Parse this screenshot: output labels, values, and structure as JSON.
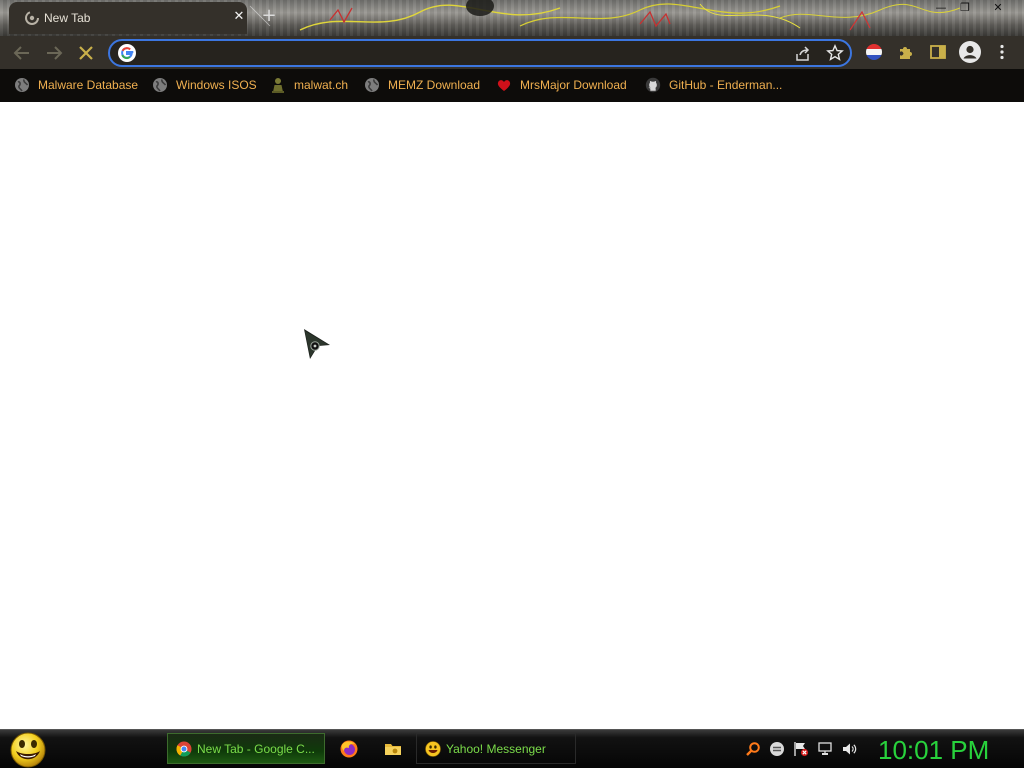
{
  "window": {
    "minimize_glyph": "—",
    "restore_glyph": "❐",
    "close_glyph": "✕"
  },
  "tabs": [
    {
      "title": "New Tab",
      "icon": "loading-spinner-icon",
      "close_glyph": "✕"
    }
  ],
  "new_tab_glyph": "+",
  "toolbar": {
    "back_icon": "arrow-left-icon",
    "forward_icon": "arrow-right-icon",
    "stop_icon": "stop-x-icon",
    "omnibox": {
      "value": "",
      "placeholder": "",
      "accent_color": "#3c76e0"
    },
    "extensions": [
      "profile-flag-icon",
      "puzzle-piece-icon",
      "side-panel-icon",
      "account-icon",
      "more-menu-icon"
    ]
  },
  "bookmarks": [
    {
      "label": "Malware Database",
      "icon": "globe-icon"
    },
    {
      "label": "Windows ISOS",
      "icon": "globe-icon"
    },
    {
      "label": "malwat.ch",
      "icon": "malwatch-icon"
    },
    {
      "label": "MEMZ Download",
      "icon": "globe-icon"
    },
    {
      "label": "MrsMajor Download",
      "icon": "heart-icon"
    },
    {
      "label": "GitHub - Enderman...",
      "icon": "github-icon"
    }
  ],
  "taskbar": {
    "start_icon": "smiley-icon",
    "tasks": [
      {
        "label": "New Tab - Google C...",
        "icon": "chrome-icon",
        "active": true
      },
      {
        "label": "Yahoo! Messenger",
        "icon": "yahoo-smiley-icon",
        "active": false
      }
    ],
    "quick_launch": [
      "firefox-icon",
      "folder-icon"
    ],
    "tray": [
      "search-icon",
      "messenger-icon",
      "action-center-flag-icon",
      "network-icon",
      "volume-icon"
    ],
    "clock": "10:01 PM",
    "clock_color": "#28d23c"
  },
  "colors": {
    "bookmark_text": "#f0b050",
    "taskbar_text": "#7bdc4a",
    "toolbar_bg": "#34302a"
  }
}
